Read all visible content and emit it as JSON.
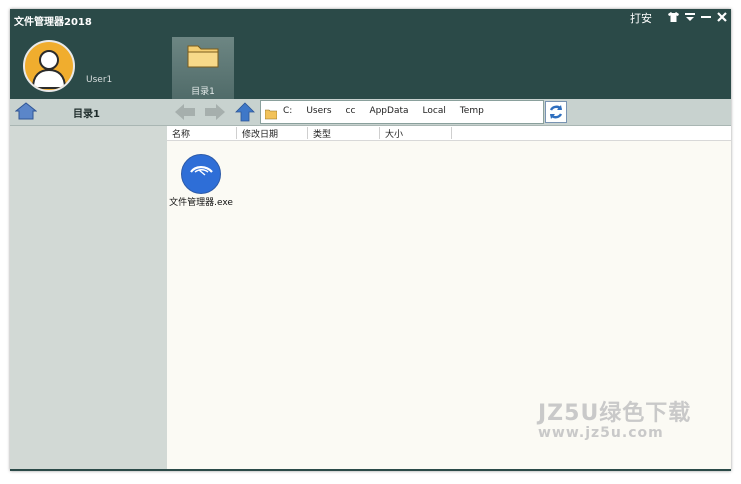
{
  "window": {
    "title": "文件管理器2018"
  },
  "top_controls": {
    "skin_label": "打安"
  },
  "user": {
    "name": "User1"
  },
  "tabs": [
    {
      "label": "目录1"
    }
  ],
  "navbar": {
    "directory_title": "目录1"
  },
  "address": {
    "crumbs": [
      "C:",
      "Users",
      "cc",
      "AppData",
      "Local",
      "Temp"
    ]
  },
  "columns": {
    "name": "名称",
    "modified": "修改日期",
    "type": "类型",
    "size": "大小"
  },
  "files": [
    {
      "name": "文件管理器.exe"
    }
  ],
  "watermark": {
    "line1": "JZ5U绿色下载",
    "line2": "www.jz5u.com"
  },
  "colors": {
    "titlebar": "#2b4a48",
    "sidebar": "#d2d9d5",
    "content": "#fbfaf4",
    "accent": "#2e6ed7"
  }
}
